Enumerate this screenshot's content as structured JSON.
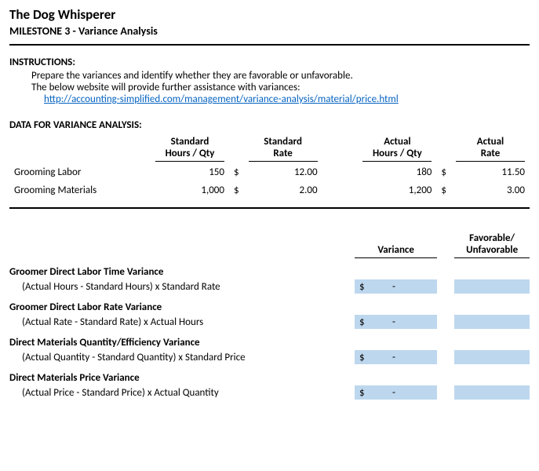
{
  "header": {
    "company": "The Dog Whisperer",
    "subtitle": "MILESTONE 3 - Variance Analysis"
  },
  "instructions": {
    "label": "INSTRUCTIONS:",
    "line1": "Prepare the variances and identify whether they are favorable or unfavorable.",
    "line2": "The below website will provide further assistance with variances:",
    "link_text": "http://accounting-simplified.com/management/variance-analysis/material/price.html"
  },
  "data_section": {
    "label": "DATA FOR VARIANCE ANALYSIS:",
    "headers": {
      "h1a": "Standard",
      "h1b": "Hours / Qty",
      "h2a": "Standard",
      "h2b": "Rate",
      "h3a": "Actual",
      "h3b": "Hours / Qty",
      "h4a": "Actual",
      "h4b": "Rate"
    },
    "rows": [
      {
        "label": "Grooming Labor",
        "std_qty": "150",
        "std_rate_cur": "$",
        "std_rate": "12.00",
        "act_qty": "180",
        "act_rate_cur": "$",
        "act_rate": "11.50"
      },
      {
        "label": "Grooming Materials",
        "std_qty": "1,000",
        "std_rate_cur": "$",
        "std_rate": "2.00",
        "act_qty": "1,200",
        "act_rate_cur": "$",
        "act_rate": "3.00"
      }
    ]
  },
  "variance_section": {
    "col1": "Variance",
    "col2_a": "Favorable/",
    "col2_b": "Unfavorable",
    "cur": "$",
    "dash": "-",
    "items": [
      {
        "title": "Groomer Direct Labor Time Variance",
        "formula": "(Actual Hours - Standard Hours) x Standard Rate"
      },
      {
        "title_html": "Groomer Direct Labor <b>Rate</b> Variance",
        "formula": "(Actual Rate - Standard Rate) x Actual Hours"
      },
      {
        "title": "Direct Materials Quantity/Efficiency Variance",
        "formula": "(Actual Quantity - Standard Quantity) x Standard Price"
      },
      {
        "title": "Direct Materials Price Variance",
        "formula": "(Actual Price - Standard Price) x Actual Quantity"
      }
    ]
  }
}
